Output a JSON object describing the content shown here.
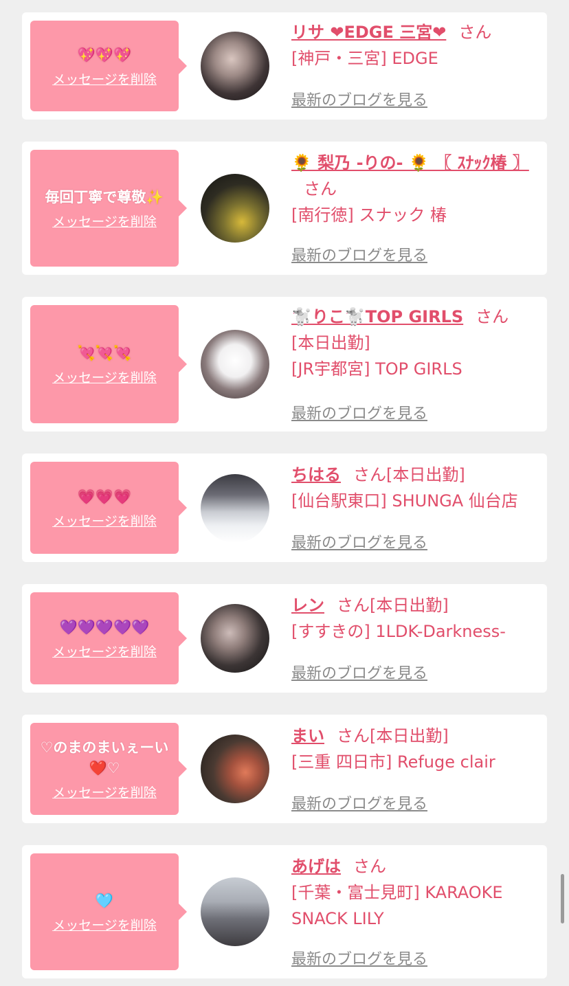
{
  "delete_label": "メッセージを削除",
  "san_suffix": "さん",
  "blog_label": "最新のブログを見る",
  "colors": {
    "bubble": "#fd98a9",
    "accent": "#e14e6b",
    "card": "#ffffff",
    "background": "#efefef"
  },
  "cards": [
    {
      "message": "💖💖💖",
      "name": "リサ ❤EDGE 三宮❤",
      "status": "",
      "shop_lines": [
        "[神戸・三宮] EDGE"
      ]
    },
    {
      "message": "毎回丁寧で尊敬✨",
      "name": "🌻 梨乃 -りの- 🌻 〖 ｽﾅｯｸ椿 〗",
      "status": "",
      "shop_lines": [
        "[南行徳] スナック 椿"
      ]
    },
    {
      "message": "💘💘💘",
      "name": "🐩りこ🐩TOP GIRLS",
      "status": "",
      "shop_lines": [
        "[本日出勤]",
        "[JR宇都宮] TOP GIRLS"
      ]
    },
    {
      "message": "💗💗💗",
      "name": "ちはる",
      "status": "[本日出勤]",
      "shop_lines": [
        "[仙台駅東口] SHUNGA 仙台店"
      ]
    },
    {
      "message": "💜💜💜💜💜",
      "name": "レン",
      "status": "[本日出勤]",
      "shop_lines": [
        "[すすきの] 1LDK-Darkness-"
      ]
    },
    {
      "message": "♡のまのまいぇーい❤️♡",
      "name": "まい",
      "status": "[本日出勤]",
      "shop_lines": [
        "[三重 四日市] Refuge clair"
      ]
    },
    {
      "message": "🩵",
      "name": "あげは",
      "status": "",
      "shop_lines": [
        "[千葉・富士見町] KARAOKE SNACK LILY"
      ]
    }
  ]
}
